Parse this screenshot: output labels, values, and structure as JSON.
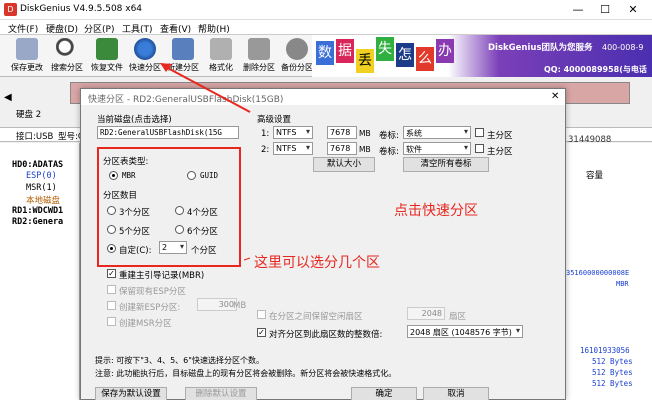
{
  "app": {
    "title": "DiskGenius V4.9.5.508 x64",
    "icon_label": "D"
  },
  "menu": [
    "文件(F)",
    "硬盘(D)",
    "分区(P)",
    "工具(T)",
    "查看(V)",
    "帮助(H)"
  ],
  "toolbar": [
    {
      "label": "保存更改",
      "icon": "save-icon"
    },
    {
      "label": "搜索分区",
      "icon": "magnifier-icon"
    },
    {
      "label": "恢复文件",
      "icon": "recover-icon"
    },
    {
      "label": "快速分区",
      "icon": "quick-partition-icon"
    },
    {
      "label": "新建分区",
      "icon": "new-partition-icon"
    },
    {
      "label": "格式化",
      "icon": "format-icon"
    },
    {
      "label": "删除分区",
      "icon": "delete-icon"
    },
    {
      "label": "备份分区",
      "icon": "backup-icon"
    }
  ],
  "banner": {
    "chars": [
      "数",
      "据",
      "丢",
      "失",
      "怎",
      "么",
      "办"
    ],
    "team": "DiskGenius团队为您服务",
    "phone": "400-008-9",
    "qq": "QQ: 4000089958(与电话"
  },
  "disk_panel": {
    "disk": "硬盘 2",
    "iface": "接口:USB",
    "model": "型号:Ge"
  },
  "tree": [
    "HD0:ADATAS",
    "ESP(0)",
    "MSR(1)",
    "本地磁盘",
    "RD1:WDCWD1",
    "RD2:Genera"
  ],
  "right_pane": {
    "header": "容量",
    "value1": "31449088",
    "hex": "35160000000008E",
    "mbr": "MBR",
    "v2": "16101933056",
    "v3": "512 Bytes",
    "v4": "512 Bytes",
    "v5": "512 Bytes"
  },
  "dialog": {
    "title": "快速分区 - RD2:GeneralUSBFlashDisk(15GB)",
    "current_disk_label": "当前磁盘(点击选择)",
    "current_disk_value": "RD2:GeneralUSBFlashDisk(15G",
    "table_type_label": "分区表类型:",
    "mbr": "MBR",
    "guid": "GUID",
    "count_label": "分区数目",
    "count_options": [
      "3个分区",
      "4个分区",
      "5个分区",
      "6个分区"
    ],
    "custom_label": "自定(C):",
    "custom_value": "2",
    "custom_suffix": "个分区",
    "rebuild_mbr": "重建主引导记录(MBR)",
    "keep_esp": "保留现有ESP分区",
    "create_esp": "创建新ESP分区:",
    "esp_size": "300",
    "esp_unit": "MB",
    "create_msr": "创建MSR分区",
    "advanced_label": "高级设置",
    "rows": [
      {
        "idx": "1:",
        "fs": "NTFS",
        "size": "7678",
        "unit": "MB",
        "vol_label_name": "卷标:",
        "vol": "系统",
        "primary": "主分区"
      },
      {
        "idx": "2:",
        "fs": "NTFS",
        "size": "7678",
        "unit": "MB",
        "vol_label_name": "卷标:",
        "vol": "软件",
        "primary": "主分区"
      }
    ],
    "default_size_btn": "默认大小",
    "clear_labels_btn": "清空所有卷标",
    "retain_free_label": "在分区之间保留空闲扇区",
    "retain_free_value": "2048",
    "retain_free_unit": "扇区",
    "align_label": "对齐分区到此扇区数的整数倍:",
    "align_value": "2048 扇区 (1048576 字节)",
    "hint": "提示: 可按下\"3、4、5、6\"快速选择分区个数。",
    "warning": "注意: 此功能执行后，目标磁盘上的现有分区将会被删除。新分区将会被快速格式化。",
    "save_default_btn": "保存为默认设置",
    "delete_default_btn": "删除默认设置",
    "ok_btn": "确定",
    "cancel_btn": "取消"
  },
  "annotations": {
    "quick": "点击快速分区",
    "count": "这里可以选分几个区"
  }
}
